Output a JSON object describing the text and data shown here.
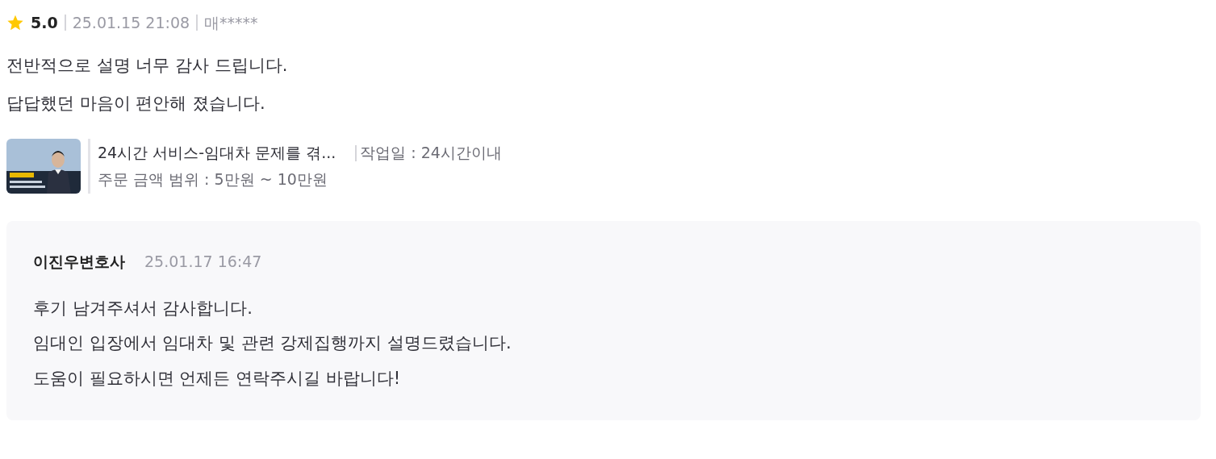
{
  "review": {
    "rating": "5.0",
    "date": "25.01.15 21:08",
    "author": "매*****",
    "lines": [
      "전반적으로 설명 너무 감사 드립니다.",
      "답답했던 마음이 편안해 졌습니다."
    ]
  },
  "service": {
    "title": "24시간 서비스-임대차 문제를 겪...",
    "work_period": "작업일 : 24시간이내",
    "price_range": "주문 금액 범위 : 5만원 ~ 10만원"
  },
  "reply": {
    "author": "이진우변호사",
    "date": "25.01.17 16:47",
    "lines": [
      "후기 남겨주셔서 감사합니다.",
      "임대인 입장에서 임대차 및 관련 강제집행까지 설명드렸습니다.",
      "도움이 필요하시면 언제든 연락주시길 바랍니다!"
    ]
  }
}
